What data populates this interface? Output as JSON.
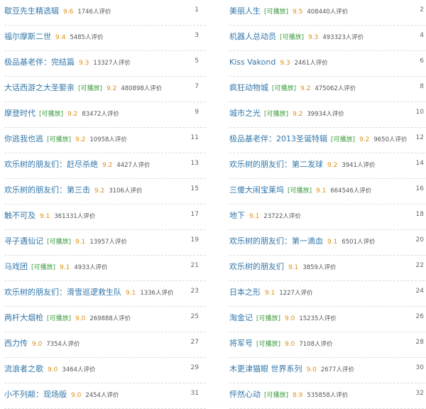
{
  "list": {
    "left": [
      {
        "rank": "1",
        "title": "歇豆先生精选辑",
        "tag": "",
        "rating": "9.6",
        "count": "1746人评价"
      },
      {
        "rank": "3",
        "title": "福尔摩斯二世",
        "tag": "",
        "rating": "9.4",
        "count": "5485人评价"
      },
      {
        "rank": "5",
        "title": "极品基老伴：完结篇",
        "tag": "",
        "rating": "9.3",
        "count": "13327人评价"
      },
      {
        "rank": "7",
        "title": "大话西游之大圣娶亲",
        "tag": "[可播放]",
        "rating": "9.2",
        "count": "480898人评价"
      },
      {
        "rank": "9",
        "title": "摩登时代",
        "tag": "[可播放]",
        "rating": "9.2",
        "count": "83472人评价"
      },
      {
        "rank": "11",
        "title": "你逃我也逃",
        "tag": "[可播放]",
        "rating": "9.2",
        "count": "10958人评价"
      },
      {
        "rank": "13",
        "title": "欢乐树的朋友们：赶尽杀绝",
        "tag": "",
        "rating": "9.2",
        "count": "4427人评价"
      },
      {
        "rank": "15",
        "title": "欢乐树的朋友们：第三击",
        "tag": "",
        "rating": "9.2",
        "count": "3106人评价"
      },
      {
        "rank": "17",
        "title": "触不可及",
        "tag": "",
        "rating": "9.1",
        "count": "361331人评价"
      },
      {
        "rank": "19",
        "title": "寻子遇仙记",
        "tag": "[可播放]",
        "rating": "9.1",
        "count": "13957人评价"
      },
      {
        "rank": "21",
        "title": "马戏团",
        "tag": "[可播放]",
        "rating": "9.1",
        "count": "4933人评价"
      },
      {
        "rank": "23",
        "title": "欢乐树的朋友们：滑雪巡逻救生队",
        "tag": "",
        "rating": "9.1",
        "count": "1336人评价"
      },
      {
        "rank": "25",
        "title": "两杆大烟枪",
        "tag": "[可播放]",
        "rating": "9.0",
        "count": "269888人评价"
      },
      {
        "rank": "27",
        "title": "西力传",
        "tag": "",
        "rating": "9.0",
        "count": "7354人评价"
      },
      {
        "rank": "29",
        "title": "流浪者之歌",
        "tag": "",
        "rating": "9.0",
        "count": "3464人评价"
      },
      {
        "rank": "31",
        "title": "小不列颠：现场版",
        "tag": "",
        "rating": "9.0",
        "count": "2454人评价"
      }
    ],
    "right": [
      {
        "rank": "2",
        "title": "美丽人生",
        "tag": "[可播放]",
        "rating": "9.5",
        "count": "408440人评价"
      },
      {
        "rank": "4",
        "title": "机器人总动员",
        "tag": "[可播放]",
        "rating": "9.3",
        "count": "493323人评价"
      },
      {
        "rank": "6",
        "title": "Kiss Vakond",
        "tag": "",
        "rating": "9.3",
        "count": "2461人评价"
      },
      {
        "rank": "8",
        "title": "疯狂动物城",
        "tag": "[可播放]",
        "rating": "9.2",
        "count": "475062人评价"
      },
      {
        "rank": "10",
        "title": "城市之光",
        "tag": "[可播放]",
        "rating": "9.2",
        "count": "39934人评价"
      },
      {
        "rank": "12",
        "title": "极品基老伴：2013圣诞特辑",
        "tag": "[可播放]",
        "rating": "9.2",
        "count": "9650人评价"
      },
      {
        "rank": "14",
        "title": "欢乐树的朋友们：第二发球",
        "tag": "",
        "rating": "9.2",
        "count": "3941人评价"
      },
      {
        "rank": "16",
        "title": "三傻大闹宝莱坞",
        "tag": "[可播放]",
        "rating": "9.1",
        "count": "664546人评价"
      },
      {
        "rank": "18",
        "title": "地下",
        "tag": "",
        "rating": "9.1",
        "count": "23722人评价"
      },
      {
        "rank": "20",
        "title": "欢乐树的朋友们：第一滴血",
        "tag": "",
        "rating": "9.1",
        "count": "6501人评价"
      },
      {
        "rank": "22",
        "title": "欢乐树的朋友们",
        "tag": "",
        "rating": "9.1",
        "count": "3859人评价"
      },
      {
        "rank": "24",
        "title": "日本之形",
        "tag": "",
        "rating": "9.1",
        "count": "1227人评价"
      },
      {
        "rank": "26",
        "title": "淘金记",
        "tag": "[可播放]",
        "rating": "9.0",
        "count": "15235人评价"
      },
      {
        "rank": "28",
        "title": "将军号",
        "tag": "[可播放]",
        "rating": "9.0",
        "count": "7108人评价"
      },
      {
        "rank": "30",
        "title": "木更津猫眼 世界系列",
        "tag": "",
        "rating": "9.0",
        "count": "2677人评价"
      },
      {
        "rank": "32",
        "title": "怦然心动",
        "tag": "[可播放]",
        "rating": "8.9",
        "count": "535858人评价"
      }
    ]
  },
  "colors": {
    "title": "#3377aa",
    "tag": "#3a9b3a",
    "rating": "#e09015",
    "count": "#555555",
    "rank": "#666666",
    "divider": "#dcdcdc"
  }
}
